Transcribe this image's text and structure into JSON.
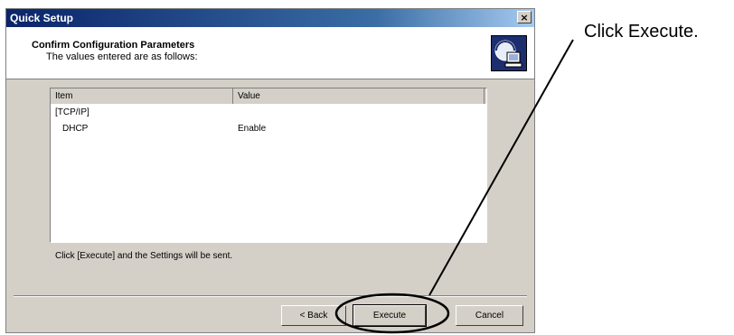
{
  "window": {
    "title": "Quick Setup",
    "close_glyph": "×"
  },
  "header": {
    "title": "Confirm Configuration Parameters",
    "subtitle": "The values entered are as follows:",
    "icon": "network-computer-icon"
  },
  "table": {
    "columns": [
      "Item",
      "Value"
    ],
    "rows": [
      {
        "item": "[TCP/IP]",
        "value": ""
      },
      {
        "item": "DHCP",
        "value": "Enable"
      }
    ]
  },
  "hint_text": "Click [Execute] and the Settings will be sent.",
  "buttons": {
    "back": "< Back",
    "execute": "Execute",
    "cancel": "Cancel"
  },
  "callout": {
    "text": "Click Execute."
  }
}
